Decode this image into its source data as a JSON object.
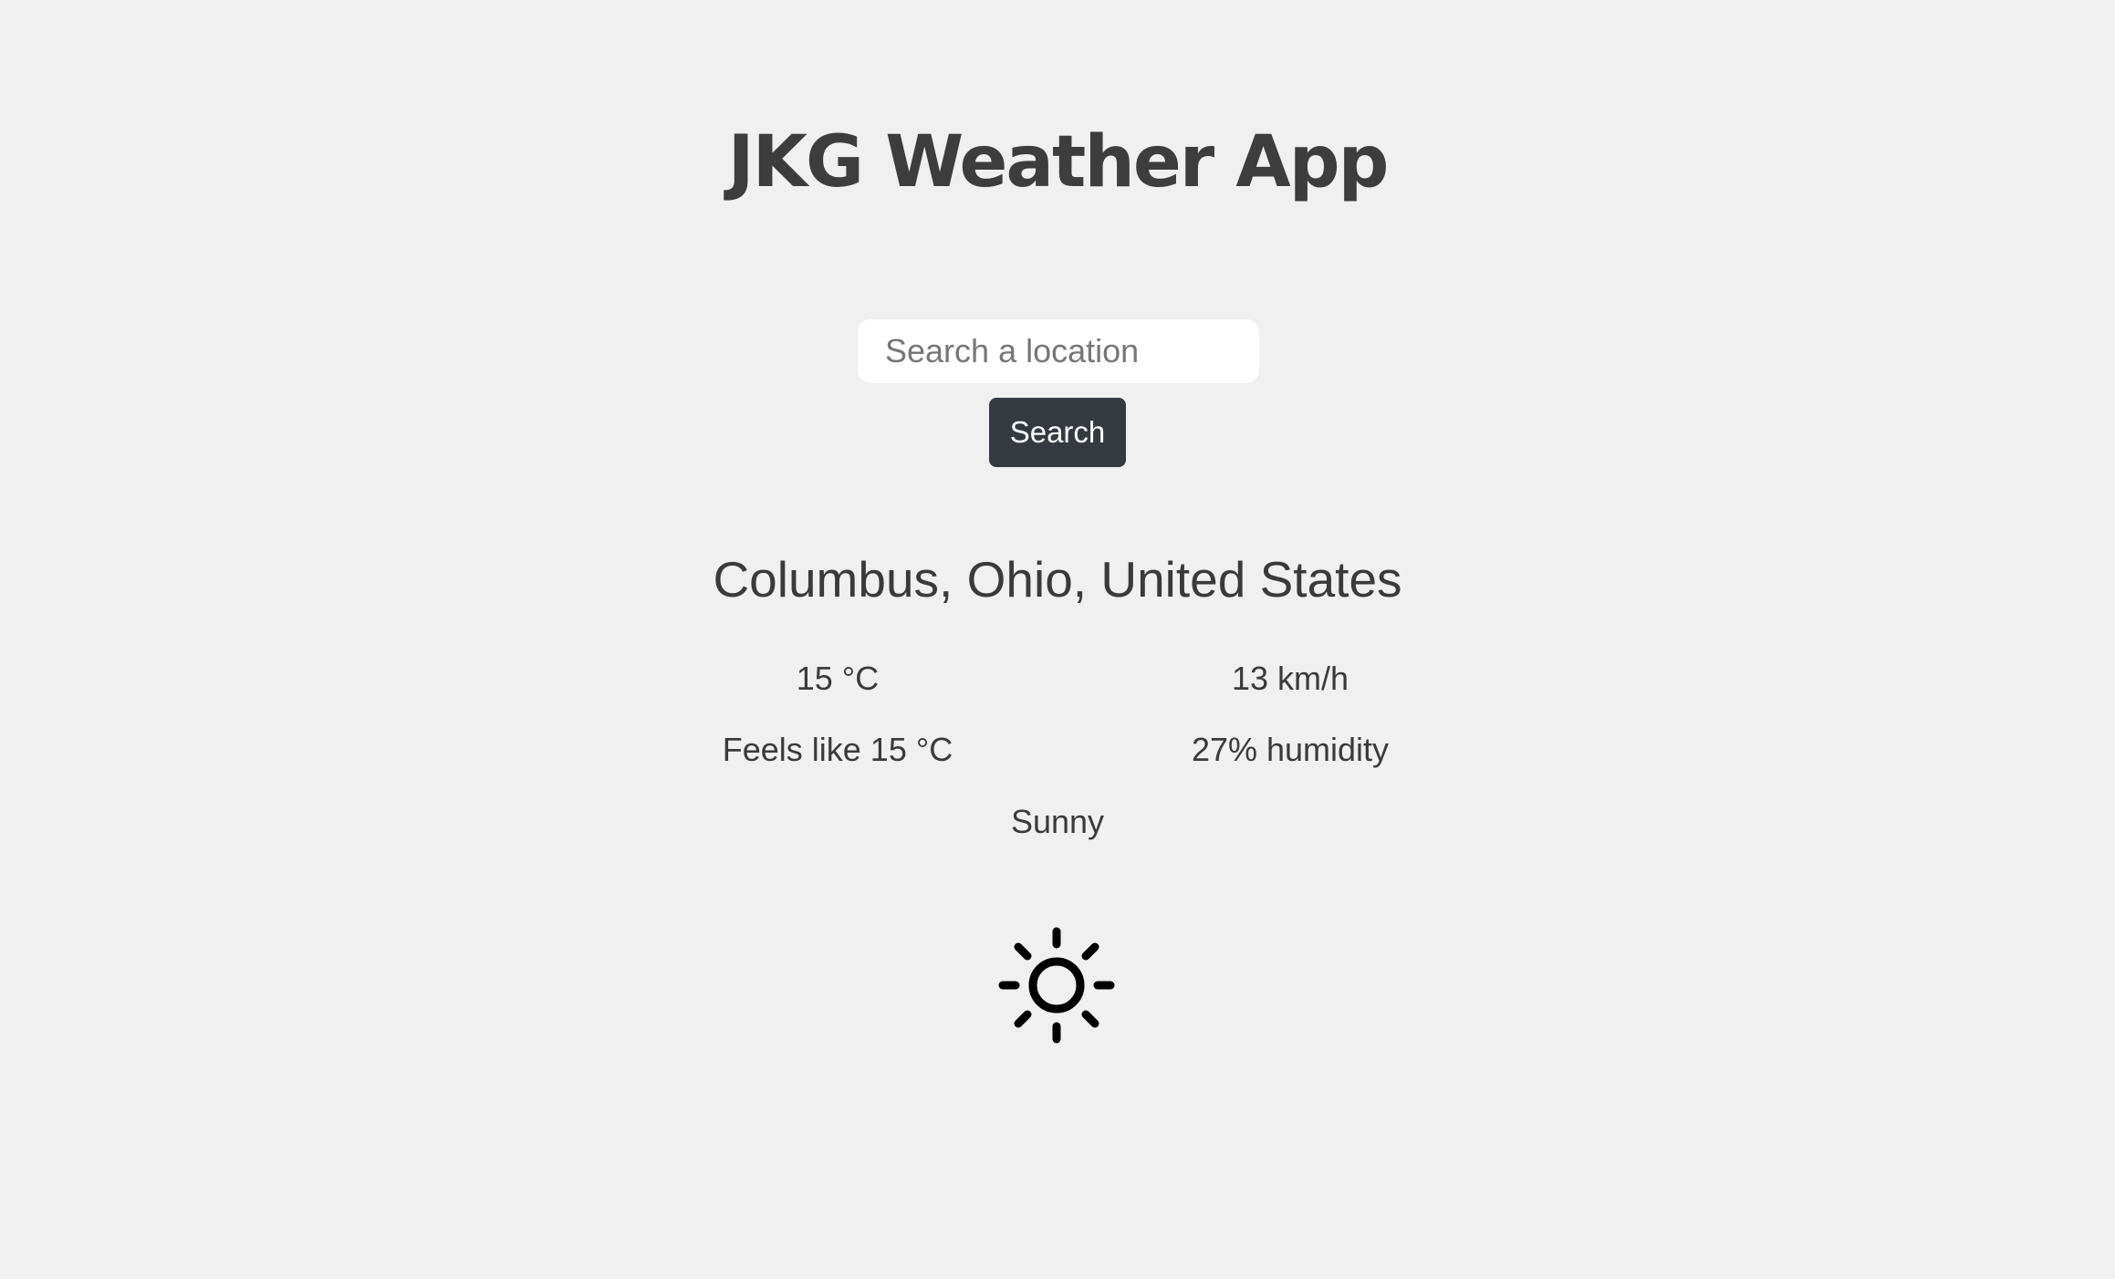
{
  "app": {
    "title": "JKG Weather App"
  },
  "search": {
    "placeholder": "Search a location",
    "value": "",
    "button_label": "Search"
  },
  "weather": {
    "location": "Columbus, Ohio, United States",
    "temperature": "15 °C",
    "wind_speed": "13 km/h",
    "feels_like": "Feels like 15 °C",
    "humidity": "27% humidity",
    "condition": "Sunny",
    "icon": "sun-icon"
  },
  "colors": {
    "background": "#f0f0f0",
    "text": "#3a3a3a",
    "button_background": "#343a40",
    "button_text": "#ffffff",
    "input_background": "#ffffff"
  }
}
